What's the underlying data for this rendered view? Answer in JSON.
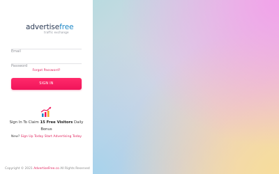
{
  "logo": {
    "part1": "advertise",
    "part2": "free",
    "tagline": "traffic exchange"
  },
  "form": {
    "email_placeholder": "Email",
    "password_placeholder": "Password",
    "forgot_label": "Forgot Password?",
    "signin_label": "SIGN IN"
  },
  "promo": {
    "icon": "chart-up-icon",
    "line_prefix": "Sign In To Claim ",
    "line_bold": "15 Free Visitors",
    "line_suffix": " Daily Bonus"
  },
  "signup": {
    "prefix": "New?",
    "link_label": "Sign Up Today Start Advertising Today"
  },
  "footer": {
    "prefix": "Copyright © 2021",
    "brand": "AdvertiseFree.co",
    "suffix": "All Rights Reserved"
  },
  "colors": {
    "accent": "#f0145a",
    "logo_dark": "#2c3b55",
    "logo_blue": "#1e88c7"
  }
}
